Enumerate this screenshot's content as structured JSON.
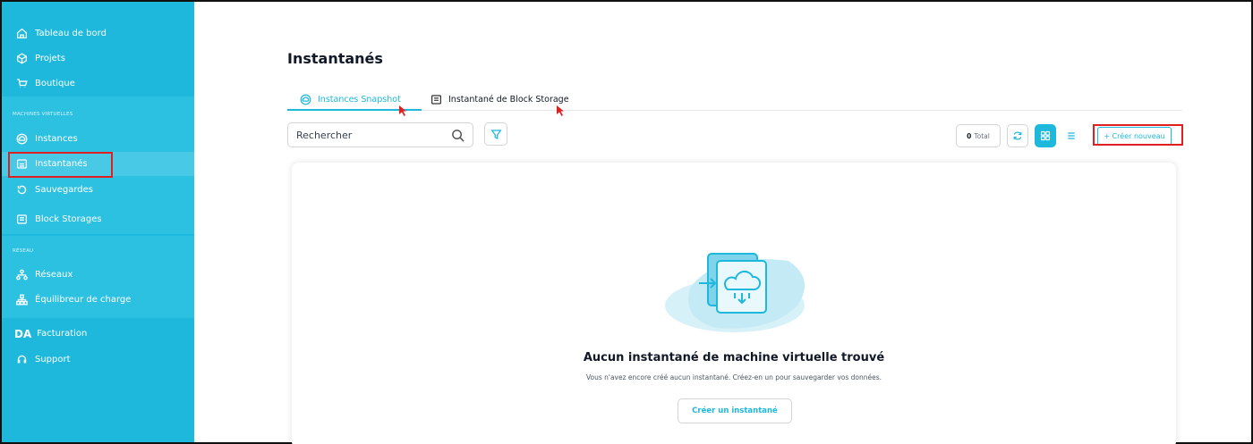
{
  "sidebar": {
    "items_top": [
      {
        "label": "Tableau de bord",
        "icon": "home-icon"
      },
      {
        "label": "Projets",
        "icon": "cube-icon"
      },
      {
        "label": "Boutique",
        "icon": "cart-icon"
      }
    ],
    "section_vm": "MACHINES VIRTUELLES",
    "items_vm": [
      {
        "label": "Instances",
        "icon": "cloud-icon"
      },
      {
        "label": "Instantanés",
        "icon": "snapshot-icon"
      },
      {
        "label": "Sauvegardes",
        "icon": "backup-icon"
      },
      {
        "label": "Block Storages",
        "icon": "storage-icon"
      }
    ],
    "section_net": "RÉSEAU",
    "items_net": [
      {
        "label": "Réseaux",
        "icon": "network-icon"
      },
      {
        "label": "Équilibreur de charge",
        "icon": "loadbalancer-icon"
      }
    ],
    "billing": {
      "prefix": "DA",
      "label": "Facturation"
    },
    "support": {
      "label": "Support",
      "icon": "headset-icon"
    }
  },
  "page": {
    "title": "Instantanés",
    "tabs": [
      {
        "label": "Instances Snapshot",
        "active": true,
        "icon": "cloud-icon"
      },
      {
        "label": "Instantané de Block Storage",
        "active": false,
        "icon": "storage-icon"
      }
    ],
    "search_placeholder": "Rechercher",
    "total_count": "0",
    "total_label": "Total",
    "create_button": "+ Créer nouveau"
  },
  "empty_state": {
    "title": "Aucun instantané de machine virtuelle trouvé",
    "subtitle": "Vous n'avez encore créé aucun instantané. Créez-en un pour sauvegarder vos données.",
    "button": "Créer un instantané"
  },
  "colors": {
    "accent": "#1db8dc",
    "highlight": "#e02020"
  }
}
